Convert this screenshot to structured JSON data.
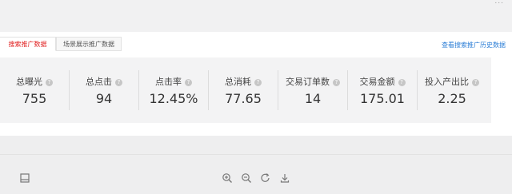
{
  "tabs": [
    {
      "label": "搜索推广数据",
      "active": true
    },
    {
      "label": "场景展示推广数据",
      "active": false
    }
  ],
  "history_link": "查看搜索推广历史数据",
  "stats": [
    {
      "label": "总曝光",
      "value": "755"
    },
    {
      "label": "总点击",
      "value": "94"
    },
    {
      "label": "点击率",
      "value": "12.45%"
    },
    {
      "label": "总消耗",
      "value": "77.65"
    },
    {
      "label": "交易订单数",
      "value": "14"
    },
    {
      "label": "交易金额",
      "value": "175.01"
    },
    {
      "label": "投入产出比",
      "value": "2.25"
    }
  ],
  "help_glyph": "?",
  "top_dots": "...",
  "colors": {
    "active_tab": "#e01c1c",
    "link": "#2a7dd6",
    "stats_bg": "#f3f3f4"
  },
  "icons": {
    "sidebar_toggle": "panel-icon",
    "zoom_in": "zoom-in-icon",
    "zoom_out": "zoom-out-icon",
    "rotate": "rotate-icon",
    "download": "download-icon"
  }
}
